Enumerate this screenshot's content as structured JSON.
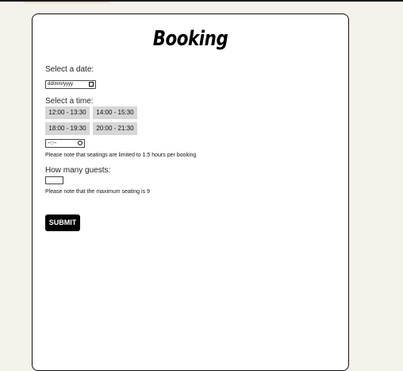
{
  "form": {
    "title": "Booking",
    "date_label": "Select a date:",
    "date_placeholder": "dd/mm/yyyy",
    "time_label": "Select a time:",
    "time_slots": [
      "12:00 - 13:30",
      "14:00 - 15:30",
      "18:00 - 19:30",
      "20:00 - 21:30"
    ],
    "time_placeholder": "--:--",
    "seating_note": "Please note that seatings are limited to 1.5 hours per booking",
    "guests_label": "How many guests:",
    "guests_value": "",
    "max_note": "Please note that the maximum seating is 9",
    "submit_label": "SUBMIT"
  },
  "icons": {
    "date": "calendar-icon",
    "time": "clock-icon"
  }
}
